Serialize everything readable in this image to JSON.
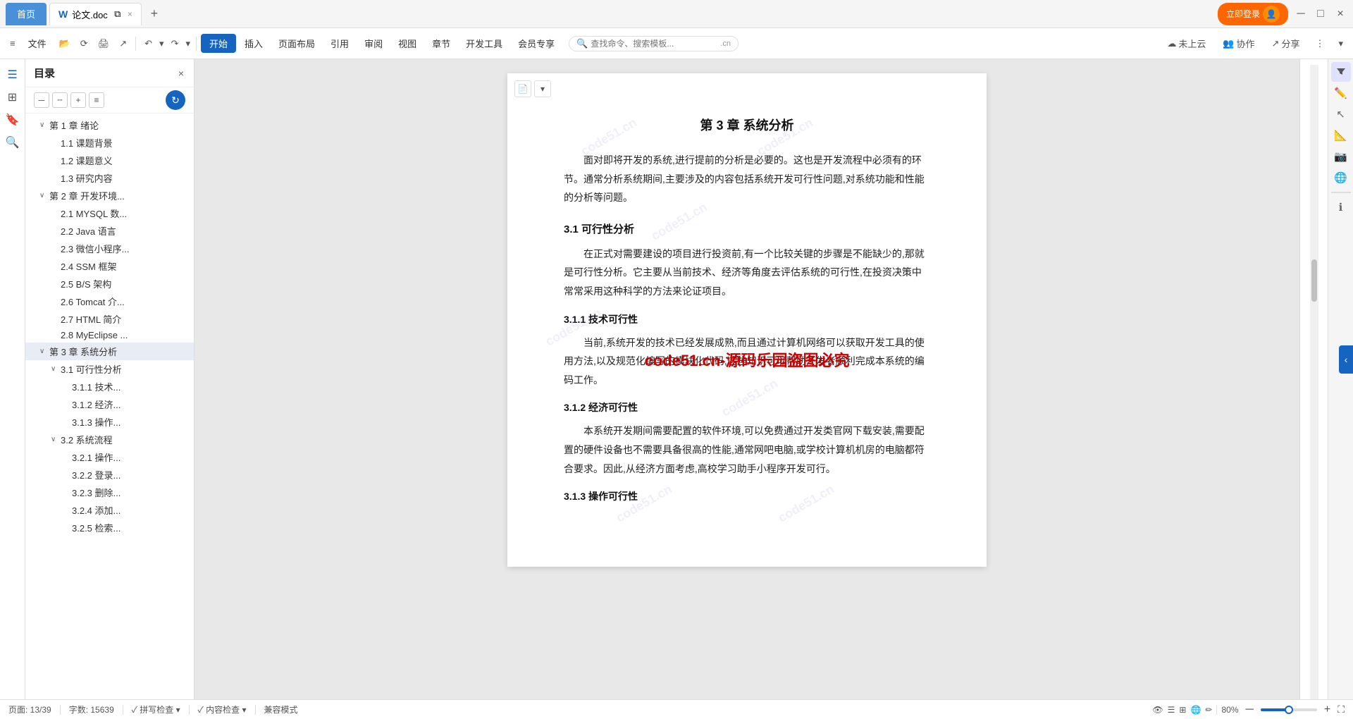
{
  "titlebar": {
    "home_tab": "首页",
    "tab1_icon": "W",
    "tab1_label": "论文.doc",
    "tab1_close": "×",
    "tab_add": "+",
    "login_btn": "立即登录",
    "min_btn": "─",
    "max_btn": "□",
    "close_btn": "×"
  },
  "toolbar": {
    "menu_icon": "≡",
    "file_label": "文件",
    "open_icon": "📂",
    "history_icon": "⟳",
    "print_icon": "🖨",
    "export_icon": "↗",
    "undo": "↶",
    "redo": "↷",
    "undo_dropdown": "▾",
    "redo_dropdown": "▾",
    "active_btn": "开始",
    "btn_insert": "插入",
    "btn_layout": "页面布局",
    "btn_ref": "引用",
    "btn_review": "审阅",
    "btn_view": "视图",
    "btn_chapter": "章节",
    "btn_devtools": "开发工具",
    "btn_vip": "会员专享",
    "search_placeholder": "查找命令、搜索模板...",
    "search_domain": ".cn",
    "cloud_status": "未上云",
    "collab": "协作",
    "share": "分享",
    "more": "⋮",
    "expand": "▾"
  },
  "sidebar": {
    "title": "目录",
    "close_btn": "×",
    "ctrl_minus_minus": "─",
    "ctrl_minus": "╌",
    "ctrl_plus": "+",
    "ctrl_minus2": "─",
    "items": [
      {
        "id": "ch1",
        "label": "第 1 章 绪论",
        "level": 1,
        "arrow": "∨",
        "expanded": true
      },
      {
        "id": "ch1-1",
        "label": "1.1 课题背景",
        "level": 2,
        "arrow": ""
      },
      {
        "id": "ch1-2",
        "label": "1.2 课题意义",
        "level": 2,
        "arrow": ""
      },
      {
        "id": "ch1-3",
        "label": "1.3 研究内容",
        "level": 2,
        "arrow": ""
      },
      {
        "id": "ch2",
        "label": "第 2 章 开发环境...",
        "level": 1,
        "arrow": "∨",
        "expanded": true
      },
      {
        "id": "ch2-1",
        "label": "2.1 MYSQL 数...",
        "level": 2,
        "arrow": ""
      },
      {
        "id": "ch2-2",
        "label": "2.2 Java 语言",
        "level": 2,
        "arrow": ""
      },
      {
        "id": "ch2-3",
        "label": "2.3 微信小程序...",
        "level": 2,
        "arrow": ""
      },
      {
        "id": "ch2-4",
        "label": "2.4 SSM 框架",
        "level": 2,
        "arrow": ""
      },
      {
        "id": "ch2-5",
        "label": "2.5 B/S 架构",
        "level": 2,
        "arrow": ""
      },
      {
        "id": "ch2-6",
        "label": "2.6 Tomcat 介...",
        "level": 2,
        "arrow": ""
      },
      {
        "id": "ch2-7",
        "label": "2.7 HTML 简介",
        "level": 2,
        "arrow": ""
      },
      {
        "id": "ch2-8",
        "label": "2.8 MyEclipse ...",
        "level": 2,
        "arrow": ""
      },
      {
        "id": "ch3",
        "label": "第 3 章 系统分析",
        "level": 1,
        "arrow": "∨",
        "expanded": true,
        "active": true
      },
      {
        "id": "ch3-1",
        "label": "3.1 可行性分析",
        "level": 2,
        "arrow": "∨",
        "expanded": true
      },
      {
        "id": "ch3-1-1",
        "label": "3.1.1 技术...",
        "level": 3,
        "arrow": ""
      },
      {
        "id": "ch3-1-2",
        "label": "3.1.2 经济...",
        "level": 3,
        "arrow": ""
      },
      {
        "id": "ch3-1-3",
        "label": "3.1.3 操作...",
        "level": 3,
        "arrow": ""
      },
      {
        "id": "ch3-2",
        "label": "3.2 系统流程",
        "level": 2,
        "arrow": "∨",
        "expanded": true
      },
      {
        "id": "ch3-2-1",
        "label": "3.2.1 操作...",
        "level": 3,
        "arrow": ""
      },
      {
        "id": "ch3-2-2",
        "label": "3.2.2 登录...",
        "level": 3,
        "arrow": ""
      },
      {
        "id": "ch3-2-3",
        "label": "3.2.3 删除...",
        "level": 3,
        "arrow": ""
      },
      {
        "id": "ch3-2-4",
        "label": "3.2.4 添加...",
        "level": 3,
        "arrow": ""
      },
      {
        "id": "ch3-2-5",
        "label": "3.2.5 检索...",
        "level": 3,
        "arrow": ""
      }
    ]
  },
  "doc": {
    "chapter_title": "第 3 章 系统分析",
    "intro_para1": "面对即将开发的系统,进行提前的分析是必要的。这也是开发流程中必须有的环节。通常分析系统期间,主要涉及的内容包括系统开发可行性问题,对系统功能和性能的分析等问题。",
    "section_3_1": "3.1  可行性分析",
    "feasibility_para": "在正式对需要建设的项目进行投资前,有一个比较关键的步骤是不能缺少的,那就是可行性分析。它主要从当前技术、经济等角度去评估系统的可行性,在投资决策中常常采用这种科学的方法来论证项目。",
    "subsection_3_1_1": "3.1.1  技术可行性",
    "tech_para": "当前,系统开发的技术已经发展成熟,而且通过计算机网络可以获取开发工具的使用方法,以及规范化编写的模块化代码,这些知识可以帮助开发者顺利完成本系统的编码工作。",
    "subsection_3_1_2": "3.1.2  经济可行性",
    "econ_para": "本系统开发期间需要配置的软件环境,可以免费通过开发类官网下载安装,需要配置的硬件设备也不需要具备很高的性能,通常网吧电脑,或学校计算机机房的电脑都符合要求。因此,从经济方面考虑,高校学习助手小程序开发可行。",
    "subsection_3_1_3": "3.1.3  操作可行性",
    "watermarks": [
      "code51.cn",
      "code51.cn",
      "code51.cn",
      "code51.cn",
      "code51.cn"
    ],
    "red_watermark": "code51.cn-源码乐园盗图必究"
  },
  "statusbar": {
    "page_label": "页面: 13/39",
    "word_count": "字数: 15639",
    "spell_check": "✓ 拼写检查 ▾",
    "content_check": "✓ 内容检查 ▾",
    "compat_mode": "兼容模式",
    "zoom_percent": "80%",
    "zoom_minus": "─",
    "zoom_plus": "+",
    "fullscreen": "⛶"
  },
  "right_panel": {
    "icons": [
      "filter",
      "pencil",
      "cursor",
      "ruler",
      "camera",
      "globe",
      "info"
    ],
    "scroll_up": "▲",
    "scroll_down": "▼"
  }
}
